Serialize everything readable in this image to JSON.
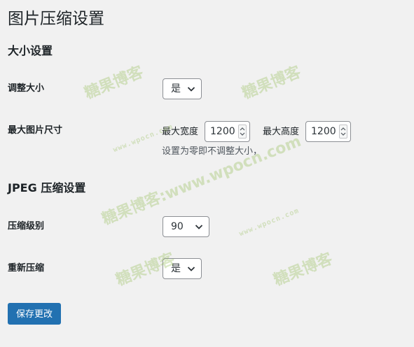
{
  "page": {
    "title": "图片压缩设置"
  },
  "size_section": {
    "title": "大小设置",
    "resize": {
      "label": "调整大小",
      "selected": "是"
    },
    "max_size": {
      "label": "最大图片尺寸",
      "width_label": "最大宽度",
      "width_value": "1200",
      "height_label": "最大高度",
      "height_value": "1200",
      "hint": "设置为零即不调整大小，"
    }
  },
  "jpeg_section": {
    "title": "JPEG 压缩设置",
    "level": {
      "label": "压缩级别",
      "selected": "90"
    },
    "recompress": {
      "label": "重新压缩",
      "selected": "是"
    }
  },
  "actions": {
    "save_label": "保存更改"
  },
  "watermarks": {
    "brand": "糖果博客",
    "brand_url": "糖果博客:www.wpocn.com",
    "url": "www.wpocn.com"
  },
  "colors": {
    "primary": "#2271b1",
    "background": "#f1f1f1",
    "watermark": "#96be5a"
  },
  "icons": {
    "select_arrow": "chevron-down-icon",
    "spinner": "spinner-arrows-icon"
  }
}
